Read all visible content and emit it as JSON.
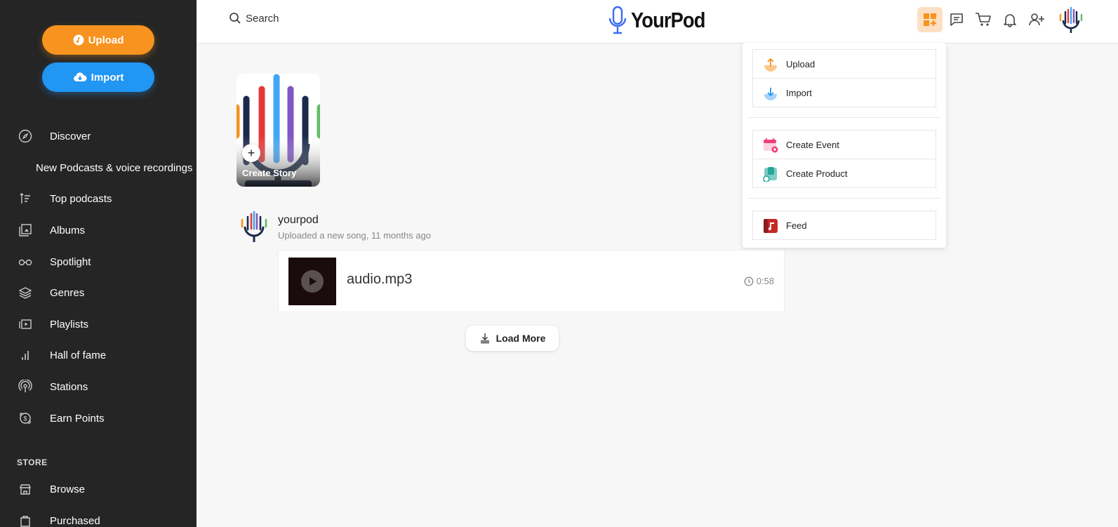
{
  "sidebar": {
    "upload_label": "Upload",
    "import_label": "Import",
    "nav": [
      {
        "label": "Discover",
        "icon": "compass-icon"
      },
      {
        "label": "New Podcasts & voice recordings",
        "icon": ""
      },
      {
        "label": "Top podcasts",
        "icon": "sort-icon"
      },
      {
        "label": "Albums",
        "icon": "album-icon"
      },
      {
        "label": "Spotlight",
        "icon": "glasses-icon"
      },
      {
        "label": "Genres",
        "icon": "layers-icon"
      },
      {
        "label": "Playlists",
        "icon": "playlist-icon"
      },
      {
        "label": "Hall of fame",
        "icon": "bar-chart-icon"
      },
      {
        "label": "Stations",
        "icon": "broadcast-icon"
      },
      {
        "label": "Earn Points",
        "icon": "coin-icon"
      }
    ],
    "store_heading": "STORE",
    "store": [
      {
        "label": "Browse",
        "icon": "store-icon"
      },
      {
        "label": "Purchased",
        "icon": "bag-icon"
      }
    ]
  },
  "header": {
    "search_label": "Search",
    "brand": "YourPod"
  },
  "create_menu": {
    "items": [
      {
        "label": "Upload",
        "icon": "upload-icon"
      },
      {
        "label": "Import",
        "icon": "import-icon"
      },
      {
        "label": "Create Event",
        "icon": "calendar-icon"
      },
      {
        "label": "Create Product",
        "icon": "product-icon"
      },
      {
        "label": "Feed",
        "icon": "music-note-icon"
      }
    ]
  },
  "story": {
    "label": "Create Story"
  },
  "post": {
    "username": "yourpod",
    "meta": "Uploaded a new song, 11 months ago",
    "track_title": "audio.mp3",
    "duration": "0:58"
  },
  "load_more_label": "Load More",
  "colors": {
    "upload": "#f7931e",
    "import": "#2196f3",
    "sidebar_bg": "#252525",
    "create_active": "#fde0c4"
  }
}
